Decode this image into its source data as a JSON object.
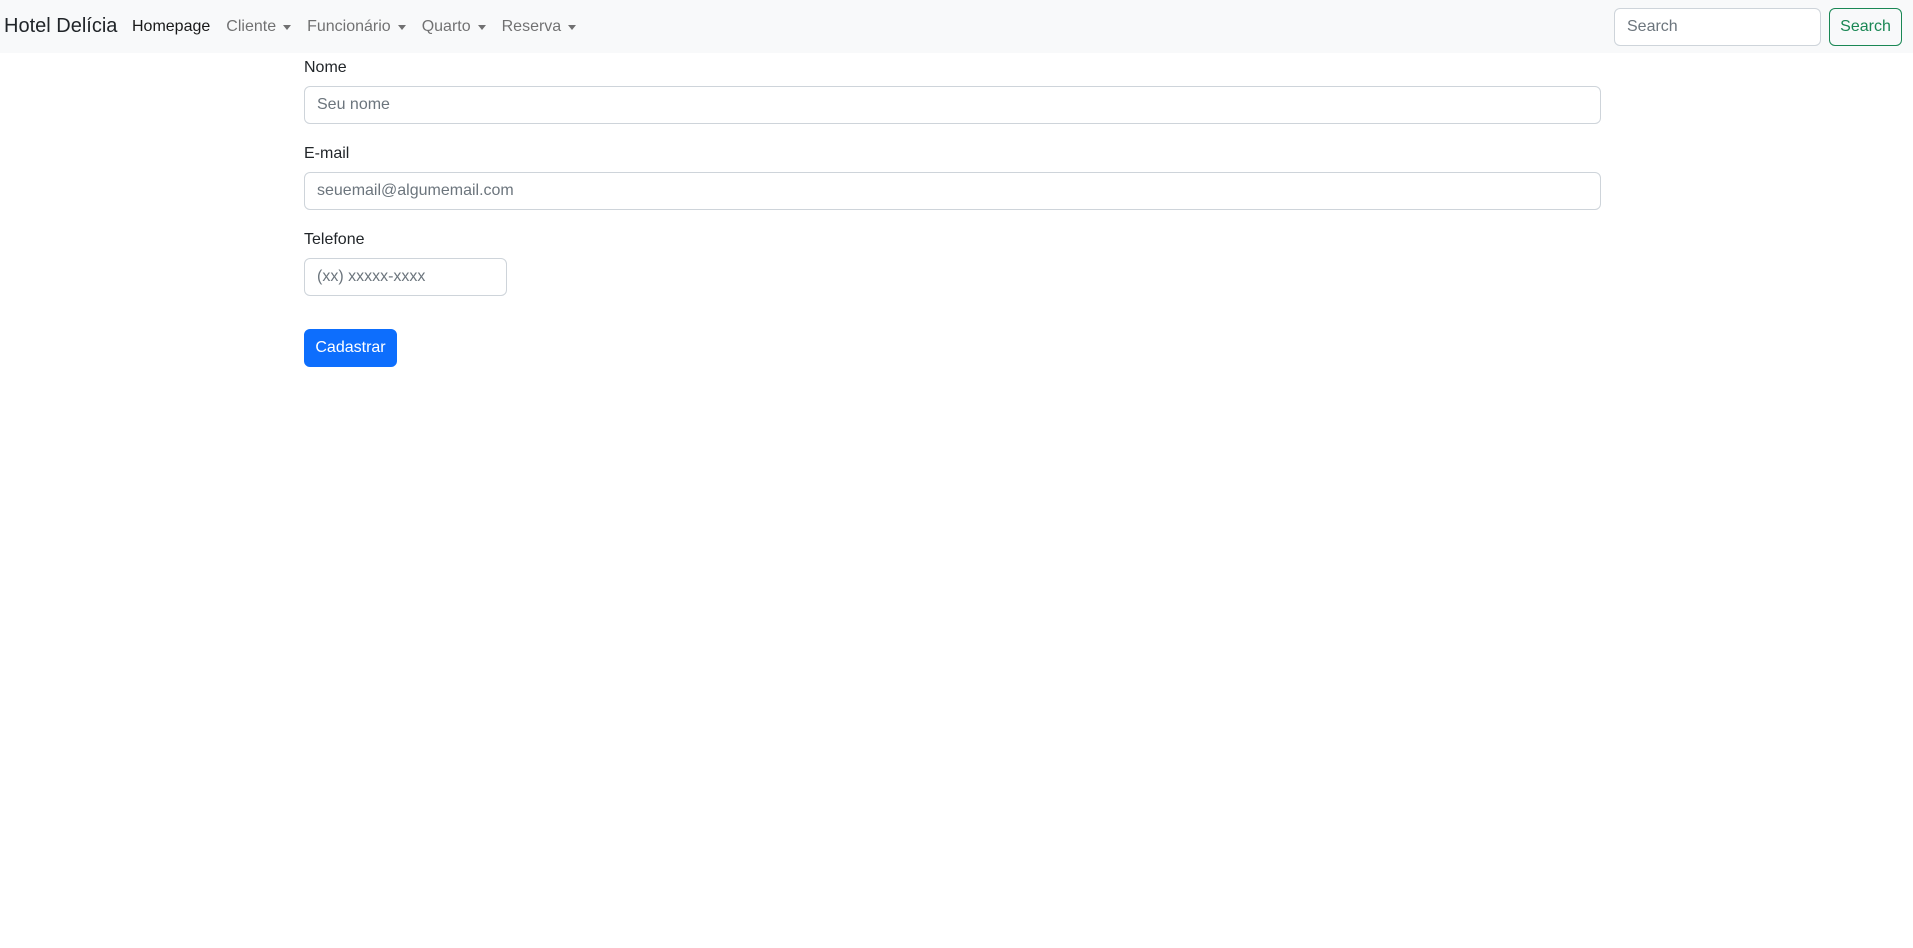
{
  "navbar": {
    "brand": "Hotel Delícia",
    "links": [
      {
        "label": "Homepage",
        "active": true,
        "dropdown": false
      },
      {
        "label": "Cliente",
        "active": false,
        "dropdown": true
      },
      {
        "label": "Funcionário",
        "active": false,
        "dropdown": true
      },
      {
        "label": "Quarto",
        "active": false,
        "dropdown": true
      },
      {
        "label": "Reserva",
        "active": false,
        "dropdown": true
      }
    ],
    "search": {
      "placeholder": "Search",
      "button_label": "Search"
    }
  },
  "form": {
    "nome": {
      "label": "Nome",
      "placeholder": "Seu nome",
      "value": ""
    },
    "email": {
      "label": "E-mail",
      "placeholder": "seuemail@algumemail.com",
      "value": ""
    },
    "telefone": {
      "label": "Telefone",
      "placeholder": "(xx) xxxxx-xxxx",
      "value": ""
    },
    "submit_label": "Cadastrar"
  },
  "colors": {
    "navbar_bg": "#f8f9fa",
    "primary": "#0d6efd",
    "success": "#198754"
  },
  "icons": {
    "dropdown": "caret-down-icon"
  }
}
